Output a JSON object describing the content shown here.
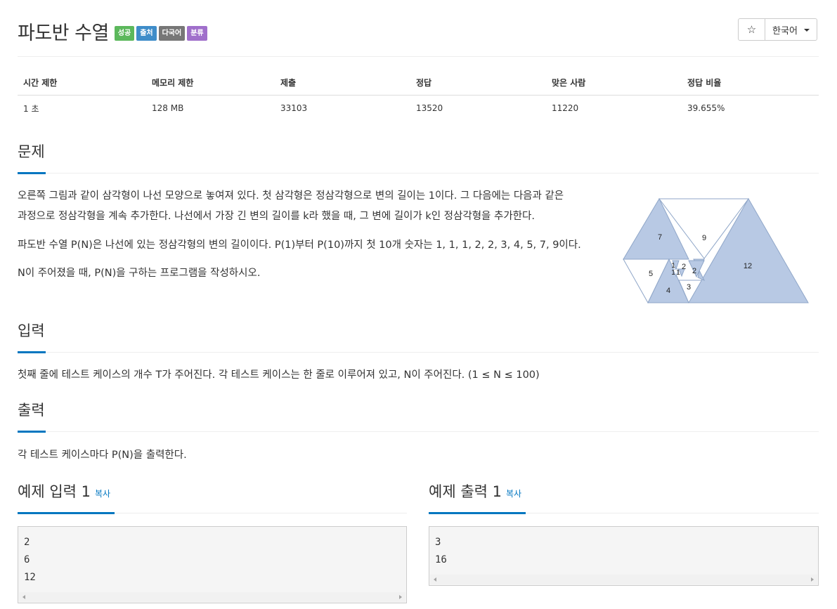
{
  "header": {
    "title": "파도반 수열",
    "badges": [
      {
        "label": "성공",
        "color": "#5cb85c"
      },
      {
        "label": "출처",
        "color": "#3f8dc9"
      },
      {
        "label": "다국어",
        "color": "#777777"
      },
      {
        "label": "분류",
        "color": "#a06fcb"
      }
    ],
    "star_icon": "☆",
    "language": "한국어"
  },
  "stats": {
    "headers": [
      "시간 제한",
      "메모리 제한",
      "제출",
      "정답",
      "맞은 사람",
      "정답 비율"
    ],
    "values": [
      "1 초",
      "128 MB",
      "33103",
      "13520",
      "11220",
      "39.655%"
    ]
  },
  "problem": {
    "heading": "문제",
    "lines": [
      "오른쪽 그림과 같이 삼각형이 나선 모양으로 놓여져 있다. 첫 삼각형은 정삼각형으로 변의 길이는 1이다. 그 다음에는 다음과 같은",
      "과정으로 정삼각형을 계속 추가한다. 나선에서 가장 긴 변의 길이를 k라 했을 때, 그 변에 길이가 k인 정삼각형을 추가한다.",
      "파도반 수열 P(N)은 나선에 있는 정삼각형의 변의 길이이다. P(1)부터 P(10)까지 첫 10개 숫자는 1, 1, 1, 2, 2, 3, 4, 5, 7, 9이다.",
      "N이 주어졌을 때, P(N)을 구하는 프로그램을 작성하시오."
    ],
    "figure_labels": [
      "7",
      "9",
      "1",
      "2",
      "1",
      "1",
      "5",
      "2",
      "12",
      "4",
      "3"
    ],
    "figure_colors": {
      "fill": "#b8c9e4",
      "stroke": "#8fa6c8"
    }
  },
  "input": {
    "heading": "입력",
    "text": "첫째 줄에 테스트 케이스의 개수 T가 주어진다. 각 테스트 케이스는 한 줄로 이루어져 있고, N이 주어진다. (1 ≤ N ≤ 100)"
  },
  "output": {
    "heading": "출력",
    "text": "각 테스트 케이스마다 P(N)을 출력한다."
  },
  "samples": {
    "input_heading": "예제 입력 1",
    "output_heading": "예제 출력 1",
    "copy_label": "복사",
    "input_text": "2\n6\n12",
    "output_text": "3\n16"
  },
  "accent": "#0076c0"
}
